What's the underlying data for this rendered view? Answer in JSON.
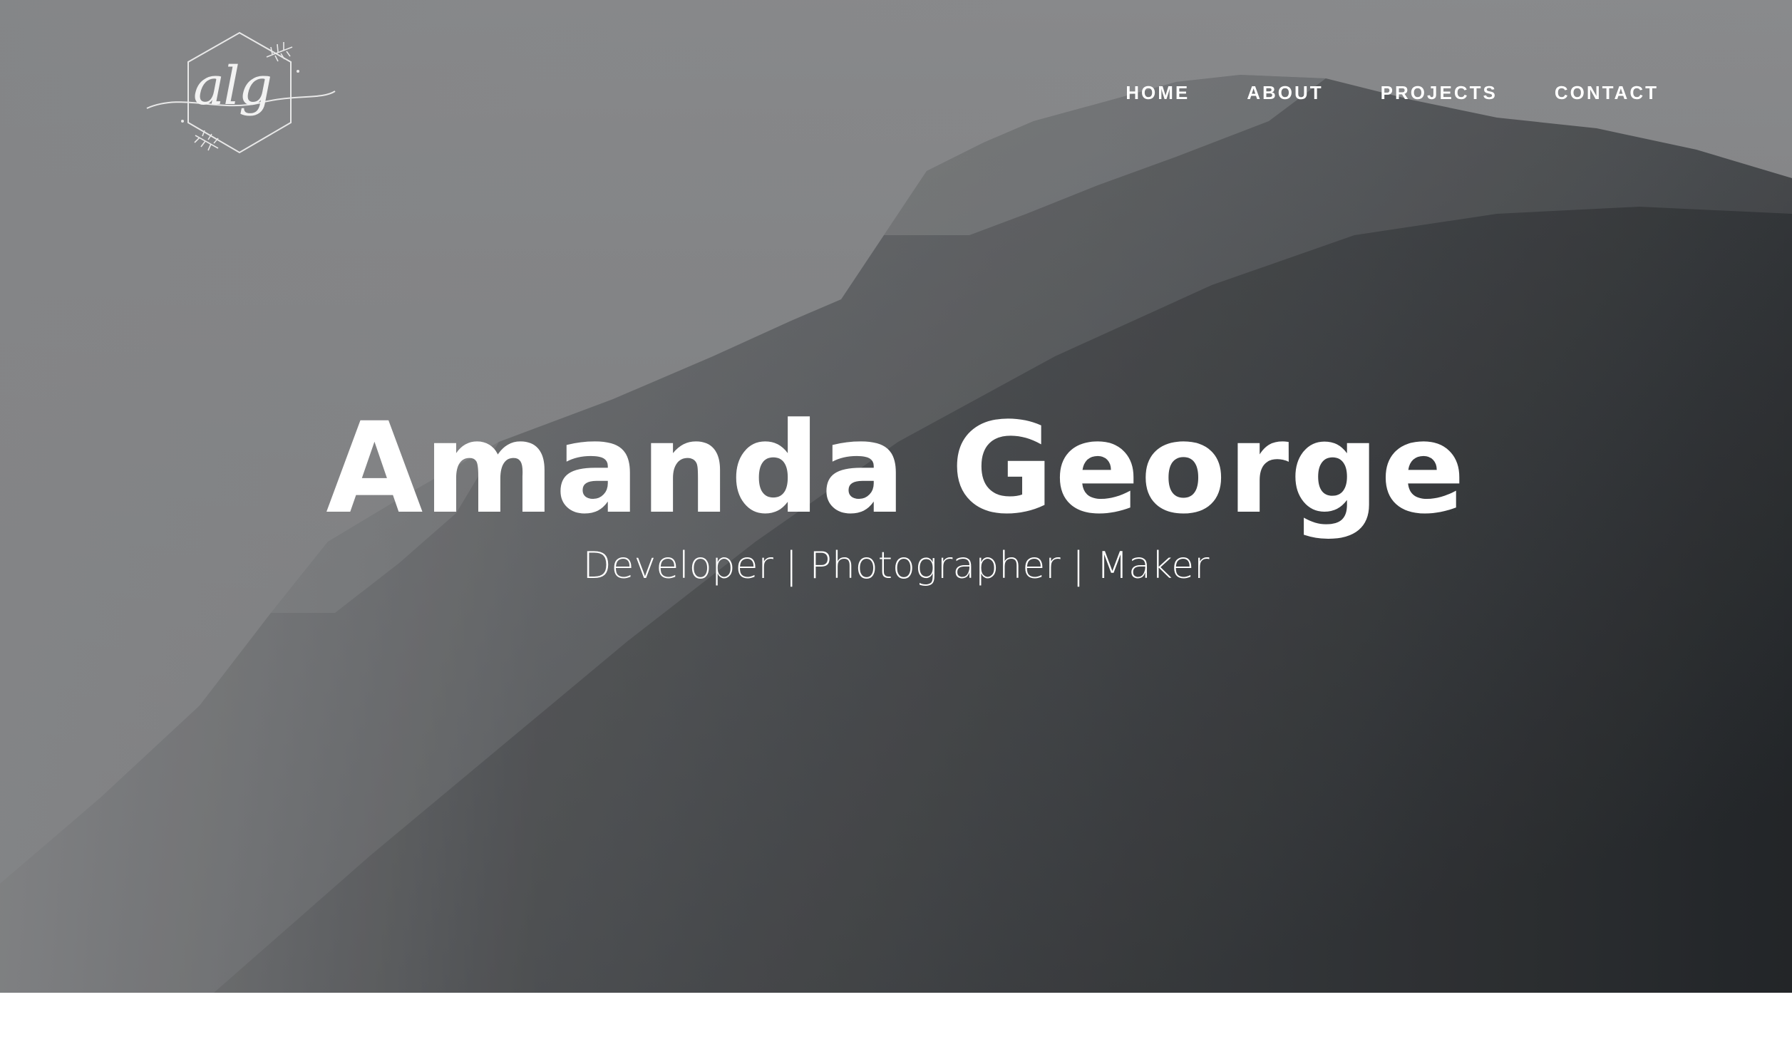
{
  "header": {
    "logo_text": "alg",
    "nav": [
      "HOME",
      "ABOUT",
      "PROJECTS",
      "CONTACT"
    ]
  },
  "hero": {
    "title": "Amanda George",
    "subtitle": "Developer | Photographer | Maker",
    "background": "foggy-mountain-photo"
  }
}
